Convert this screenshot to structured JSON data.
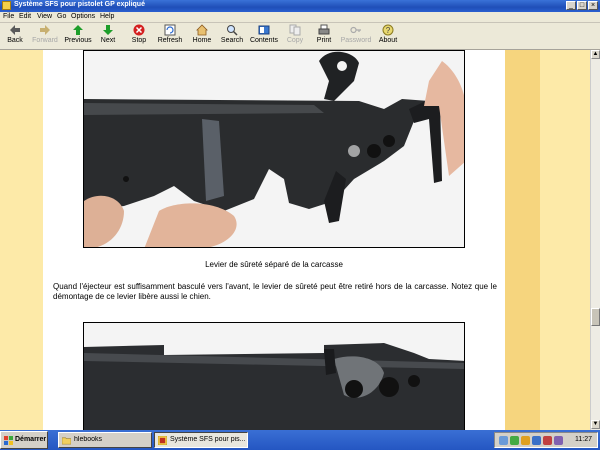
{
  "window": {
    "title": "Système SFS pour pistolet GP expliqué",
    "buttons": {
      "minimize": "_",
      "maximize": "□",
      "close": "×"
    }
  },
  "menu": [
    "File",
    "Edit",
    "View",
    "Go",
    "Options",
    "Help"
  ],
  "toolbar": [
    {
      "label": "Back",
      "icon": "back-arrow-icon",
      "enabled": true
    },
    {
      "label": "Forward",
      "icon": "forward-arrow-icon",
      "enabled": false
    },
    {
      "label": "Previous",
      "icon": "up-arrow-icon",
      "enabled": true
    },
    {
      "label": "Next",
      "icon": "down-arrow-icon",
      "enabled": true
    },
    {
      "label": "Stop",
      "icon": "stop-icon",
      "enabled": true
    },
    {
      "label": "Refresh",
      "icon": "refresh-icon",
      "enabled": true
    },
    {
      "label": "Home",
      "icon": "home-icon",
      "enabled": true
    },
    {
      "label": "Search",
      "icon": "search-icon",
      "enabled": true
    },
    {
      "label": "Contents",
      "icon": "contents-icon",
      "enabled": true
    },
    {
      "label": "Copy",
      "icon": "copy-icon",
      "enabled": false
    },
    {
      "label": "Print",
      "icon": "print-icon",
      "enabled": true
    },
    {
      "label": "Password",
      "icon": "key-icon",
      "enabled": false
    },
    {
      "label": "About",
      "icon": "about-icon",
      "enabled": true
    }
  ],
  "content": {
    "caption": "Levier de sûreté séparé de la carcasse",
    "paragraph": "Quand l'éjecteur est suffisamment basculé vers l'avant, le levier de sûreté peut être retiré hors de la carcasse. Notez que le démontage de ce levier libère aussi le chien."
  },
  "taskbar": {
    "start_label": "Démarrer",
    "tasks": [
      {
        "label": "hlebooks",
        "active": false
      },
      {
        "label": "Système SFS pour pis...",
        "active": true
      }
    ],
    "clock": "11:27"
  },
  "colors": {
    "page_background": "#fdeaa8",
    "stripe": "#f6d57e",
    "titlebar": "#1f4fb8"
  }
}
